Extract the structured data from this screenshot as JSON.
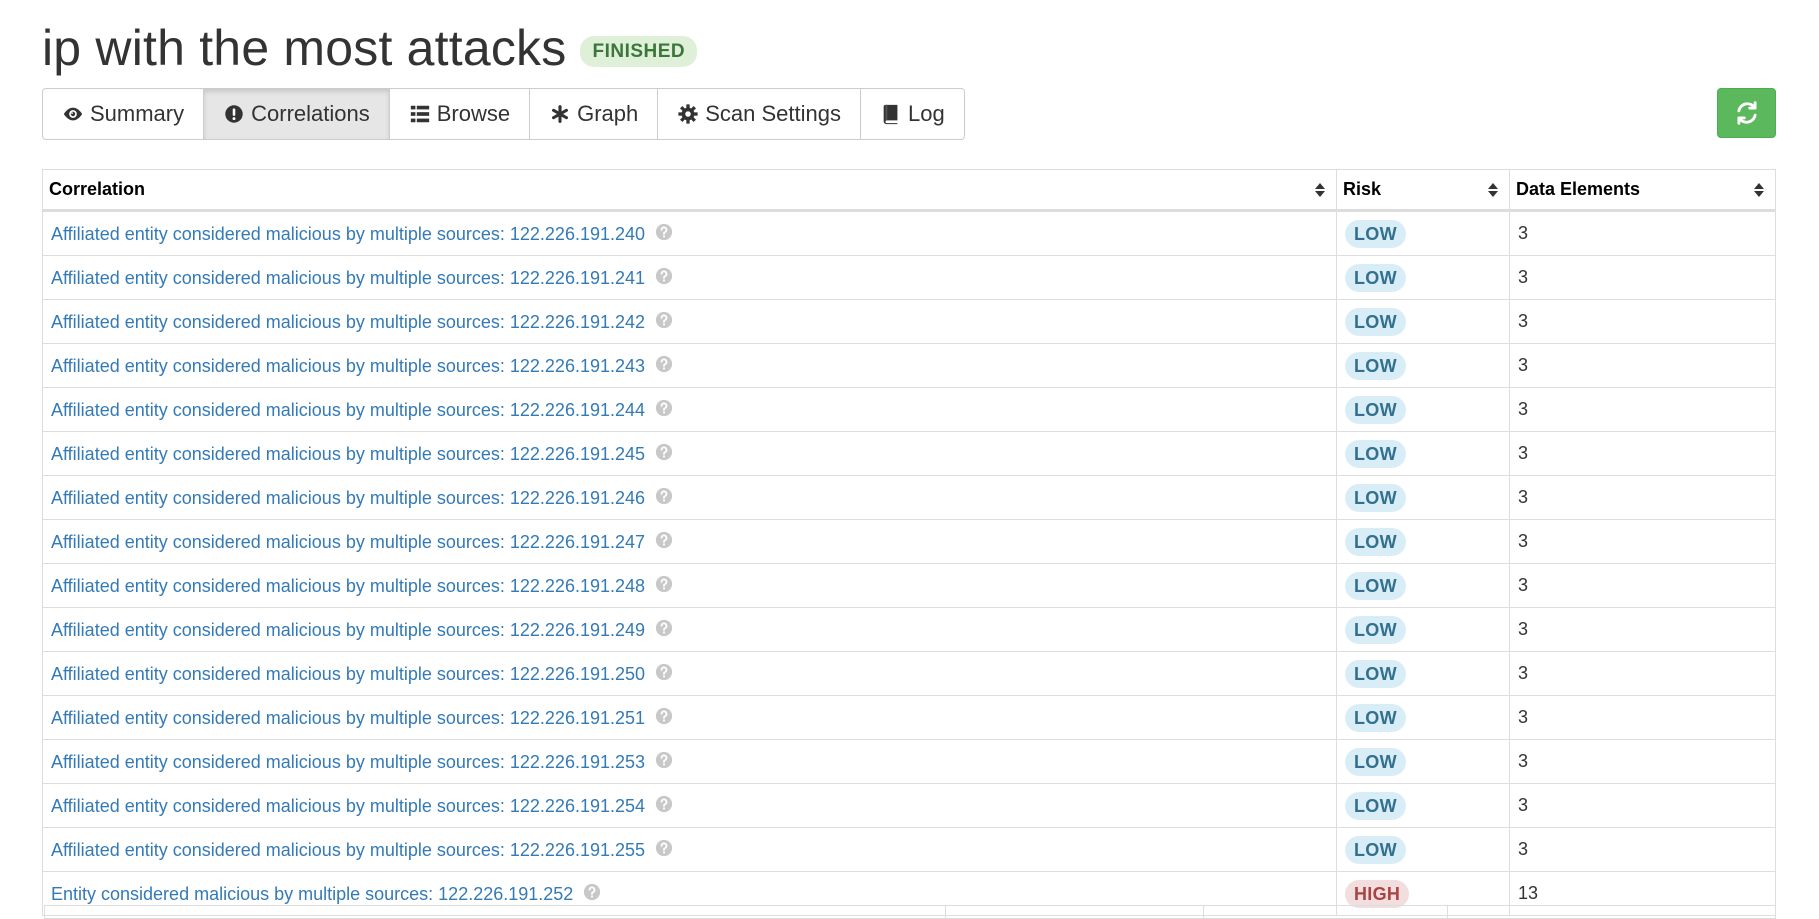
{
  "header": {
    "title": "ip with the most attacks",
    "status": "FINISHED"
  },
  "tabs": [
    {
      "label": "Summary",
      "icon": "eye-icon",
      "active": false
    },
    {
      "label": "Correlations",
      "icon": "exclamation-circle-icon",
      "active": true
    },
    {
      "label": "Browse",
      "icon": "list-icon",
      "active": false
    },
    {
      "label": "Graph",
      "icon": "asterisk-icon",
      "active": false
    },
    {
      "label": "Scan Settings",
      "icon": "cog-icon",
      "active": false
    },
    {
      "label": "Log",
      "icon": "book-icon",
      "active": false
    }
  ],
  "refresh": {
    "icon": "refresh-icon",
    "color": "#5cb85c"
  },
  "table": {
    "headers": {
      "correlation": "Correlation",
      "risk": "Risk",
      "data_elements": "Data Elements"
    },
    "rows": [
      {
        "correlation": "Affiliated entity considered malicious by multiple sources: 122.226.191.240",
        "risk": "LOW",
        "data_elements": "3"
      },
      {
        "correlation": "Affiliated entity considered malicious by multiple sources: 122.226.191.241",
        "risk": "LOW",
        "data_elements": "3"
      },
      {
        "correlation": "Affiliated entity considered malicious by multiple sources: 122.226.191.242",
        "risk": "LOW",
        "data_elements": "3"
      },
      {
        "correlation": "Affiliated entity considered malicious by multiple sources: 122.226.191.243",
        "risk": "LOW",
        "data_elements": "3"
      },
      {
        "correlation": "Affiliated entity considered malicious by multiple sources: 122.226.191.244",
        "risk": "LOW",
        "data_elements": "3"
      },
      {
        "correlation": "Affiliated entity considered malicious by multiple sources: 122.226.191.245",
        "risk": "LOW",
        "data_elements": "3"
      },
      {
        "correlation": "Affiliated entity considered malicious by multiple sources: 122.226.191.246",
        "risk": "LOW",
        "data_elements": "3"
      },
      {
        "correlation": "Affiliated entity considered malicious by multiple sources: 122.226.191.247",
        "risk": "LOW",
        "data_elements": "3"
      },
      {
        "correlation": "Affiliated entity considered malicious by multiple sources: 122.226.191.248",
        "risk": "LOW",
        "data_elements": "3"
      },
      {
        "correlation": "Affiliated entity considered malicious by multiple sources: 122.226.191.249",
        "risk": "LOW",
        "data_elements": "3"
      },
      {
        "correlation": "Affiliated entity considered malicious by multiple sources: 122.226.191.250",
        "risk": "LOW",
        "data_elements": "3"
      },
      {
        "correlation": "Affiliated entity considered malicious by multiple sources: 122.226.191.251",
        "risk": "LOW",
        "data_elements": "3"
      },
      {
        "correlation": "Affiliated entity considered malicious by multiple sources: 122.226.191.253",
        "risk": "LOW",
        "data_elements": "3"
      },
      {
        "correlation": "Affiliated entity considered malicious by multiple sources: 122.226.191.254",
        "risk": "LOW",
        "data_elements": "3"
      },
      {
        "correlation": "Affiliated entity considered malicious by multiple sources: 122.226.191.255",
        "risk": "LOW",
        "data_elements": "3"
      },
      {
        "correlation": "Entity considered malicious by multiple sources: 122.226.191.252",
        "risk": "HIGH",
        "data_elements": "13"
      }
    ]
  },
  "colors": {
    "link": "#337ab7",
    "low_badge_bg": "#d9edf7",
    "low_badge_text": "#31708f",
    "high_badge_bg": "#f2dede",
    "high_badge_text": "#a94442",
    "finished_badge_bg": "#dff0d8",
    "finished_badge_text": "#3c763d"
  }
}
